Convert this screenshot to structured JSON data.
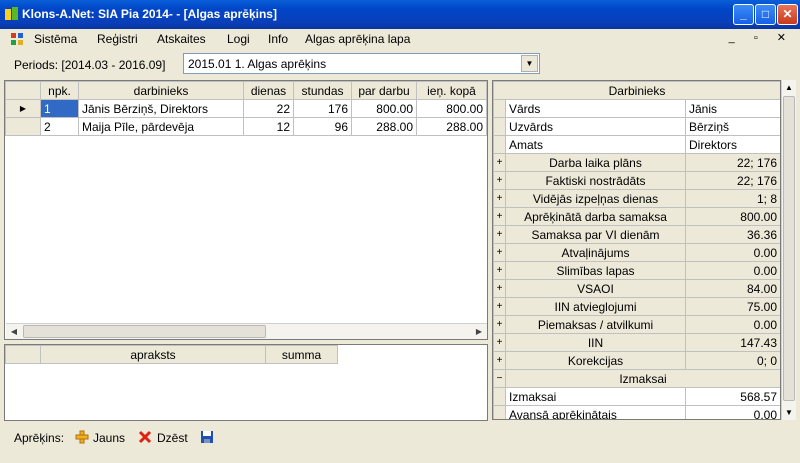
{
  "window": {
    "title": "Klons-A.Net: SIA Pia 2014- - [Algas aprēķins]"
  },
  "menu": [
    "Sistēma",
    "Reģistri",
    "Atskaites",
    "Logi",
    "Info",
    "Algas aprēķina lapa"
  ],
  "period": {
    "label": "Periods: [2014.03 - 2016.09]",
    "selected": "2015.01 1. Algas aprēķins"
  },
  "main_table": {
    "columns": [
      "npk.",
      "darbinieks",
      "dienas",
      "stundas",
      "par darbu",
      "ieņ. kopā"
    ],
    "rows": [
      [
        "1",
        "Jānis Bērziņš, Direktors",
        "22",
        "176",
        "800.00",
        "800.00"
      ],
      [
        "2",
        "Maija Pīle, pārdevēja",
        "12",
        "96",
        "288.00",
        "288.00"
      ]
    ]
  },
  "detail_table": {
    "columns": [
      "apraksts",
      "summa"
    ]
  },
  "employee_panel": {
    "header": "Darbinieks",
    "fields": [
      {
        "label": "Vārds",
        "value": "Jānis"
      },
      {
        "label": "Uzvārds",
        "value": "Bērziņš"
      },
      {
        "label": "Amats",
        "value": "Direktors"
      }
    ],
    "groups": [
      {
        "label": "Darba laika plāns",
        "value": "22; 176"
      },
      {
        "label": "Faktiski nostrādāts",
        "value": "22; 176"
      },
      {
        "label": "Vidējās izpeļņas dienas",
        "value": "1; 8"
      },
      {
        "label": "Aprēķinātā darba samaksa",
        "value": "800.00"
      },
      {
        "label": "Samaksa par VI dienām",
        "value": "36.36"
      },
      {
        "label": "Atvaļinājums",
        "value": "0.00"
      },
      {
        "label": "Slimības lapas",
        "value": "0.00"
      },
      {
        "label": "VSAOI",
        "value": "84.00"
      },
      {
        "label": "IIN atvieglojumi",
        "value": "75.00"
      },
      {
        "label": "Piemaksas / atvilkumi",
        "value": "0.00"
      },
      {
        "label": "IIN",
        "value": "147.43"
      },
      {
        "label": "Korekcijas",
        "value": "0; 0"
      }
    ],
    "payout_section": "Izmaksai",
    "payout_fields": [
      {
        "label": "Izmaksai",
        "value": "568.57"
      },
      {
        "label": "Avansā aprēķinātais",
        "value": "0.00"
      }
    ]
  },
  "statusbar": {
    "label": "Aprēķins:",
    "new": "Jauns",
    "delete": "Dzēst"
  },
  "colors": {
    "titlebar": "#0a3fb8",
    "selection": "#316ac5",
    "panel_bg": "#ece9d8"
  }
}
